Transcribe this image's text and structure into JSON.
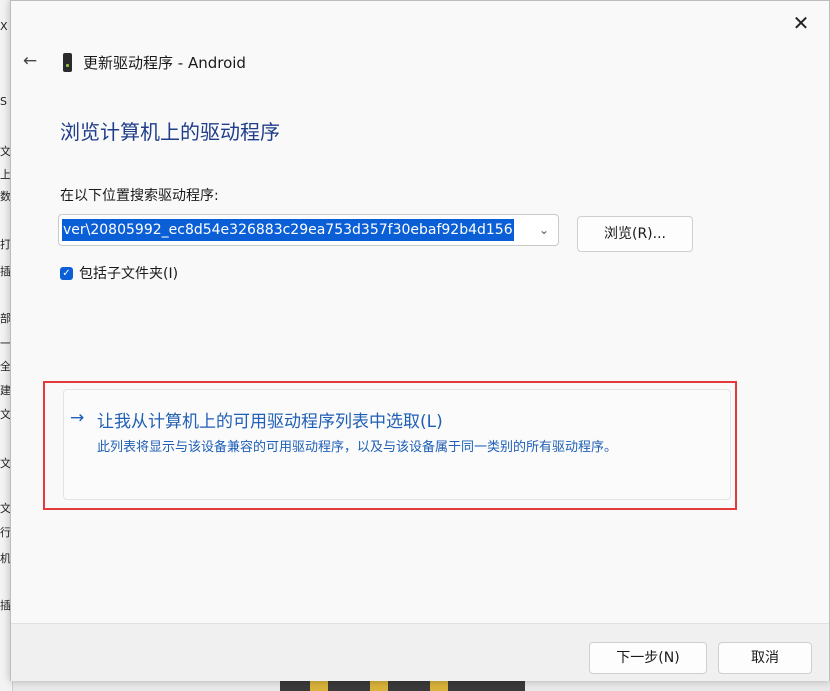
{
  "window": {
    "title": "更新驱动程序 - Android",
    "close_symbol": "✕",
    "back_symbol": "←"
  },
  "main": {
    "heading": "浏览计算机上的驱动程序",
    "search_label": "在以下位置搜索驱动程序:",
    "path_value": "ver\\20805992_ec8d54e326883c29ea753d357f30ebaf92b4d156",
    "browse_label": "浏览(R)...",
    "include_subfolders": {
      "label": "包括子文件夹(I)",
      "checked": true,
      "check_symbol": "✓"
    }
  },
  "pick_option": {
    "arrow": "→",
    "title": "让我从计算机上的可用驱动程序列表中选取(L)",
    "description": "此列表将显示与该设备兼容的可用驱动程序，以及与该设备属于同一类别的所有驱动程序。"
  },
  "footer": {
    "next_label": "下一步(N)",
    "cancel_label": "取消"
  },
  "background": {
    "left_strip_chars": [
      "X",
      "",
      "S",
      "",
      "文",
      "上",
      "数",
      "",
      "打",
      "",
      "插",
      "",
      "部",
      "",
      "一",
      "",
      "全",
      "",
      "建",
      "",
      "文",
      "",
      "文",
      "",
      "文",
      "",
      "行",
      "",
      "机",
      "",
      "插",
      ""
    ]
  },
  "colors": {
    "accent": "#0a5fd6",
    "link_text": "#1f5fb5",
    "heading_text": "#1f3d8a",
    "highlight_border": "#e33b3b"
  },
  "icons": {
    "device": "android-device-icon",
    "chevron": "chevron-down-icon",
    "close": "close-icon",
    "back": "back-arrow-icon"
  }
}
